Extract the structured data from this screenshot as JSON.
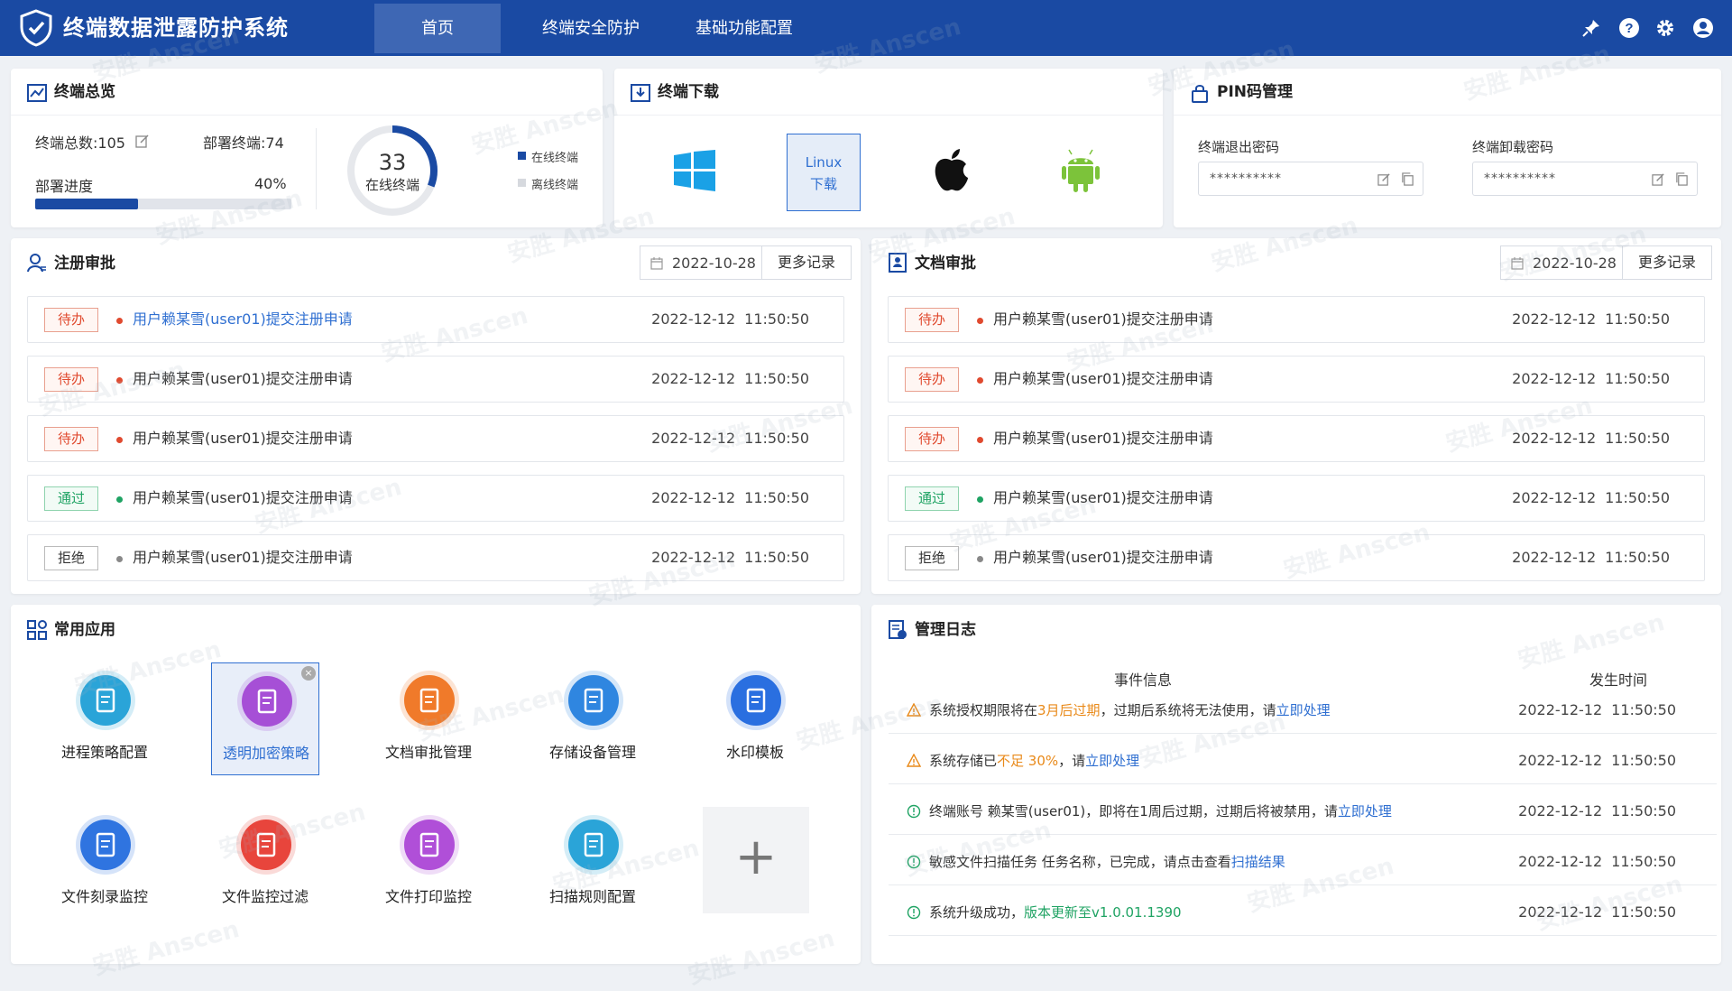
{
  "header": {
    "title": "终端数据泄露防护系统",
    "tabs": [
      {
        "label": "首页"
      },
      {
        "label": "终端安全防护"
      },
      {
        "label": "基础功能配置"
      }
    ]
  },
  "overview": {
    "title": "终端总览",
    "total_label": "终端总数:105",
    "deployed_label": "部署终端:74",
    "progress_label": "部署进度",
    "progress_text": "40%",
    "progress_value": 0.4,
    "online_count": "33",
    "online_label": "在线终端",
    "online_fraction": 0.31,
    "legend_online": "在线终端",
    "legend_offline": "离线终端"
  },
  "download": {
    "title": "终端下载",
    "linux_line1": "Linux",
    "linux_line2": "下载"
  },
  "pin": {
    "title": "PIN码管理",
    "exit_label": "终端退出密码",
    "exit_value": "**********",
    "uninstall_label": "终端卸载密码",
    "uninstall_value": "**********"
  },
  "register": {
    "title": "注册审批",
    "date": "2022-10-28",
    "more": "更多记录",
    "rows": [
      {
        "status": "待办",
        "message": "用户赖某雪(user01)提交注册申请",
        "date": "2022-12-12",
        "time": "11:50:50"
      },
      {
        "status": "待办",
        "message": "用户赖某雪(user01)提交注册申请",
        "date": "2022-12-12",
        "time": "11:50:50"
      },
      {
        "status": "待办",
        "message": "用户赖某雪(user01)提交注册申请",
        "date": "2022-12-12",
        "time": "11:50:50"
      },
      {
        "status": "通过",
        "message": "用户赖某雪(user01)提交注册申请",
        "date": "2022-12-12",
        "time": "11:50:50"
      },
      {
        "status": "拒绝",
        "message": "用户赖某雪(user01)提交注册申请",
        "date": "2022-12-12",
        "time": "11:50:50"
      }
    ]
  },
  "document": {
    "title": "文档审批",
    "date": "2022-10-28",
    "more": "更多记录",
    "rows": [
      {
        "status": "待办",
        "message": "用户赖某雪(user01)提交注册申请",
        "date": "2022-12-12",
        "time": "11:50:50"
      },
      {
        "status": "待办",
        "message": "用户赖某雪(user01)提交注册申请",
        "date": "2022-12-12",
        "time": "11:50:50"
      },
      {
        "status": "待办",
        "message": "用户赖某雪(user01)提交注册申请",
        "date": "2022-12-12",
        "time": "11:50:50"
      },
      {
        "status": "通过",
        "message": "用户赖某雪(user01)提交注册申请",
        "date": "2022-12-12",
        "time": "11:50:50"
      },
      {
        "status": "拒绝",
        "message": "用户赖某雪(user01)提交注册申请",
        "date": "2022-12-12",
        "time": "11:50:50"
      }
    ]
  },
  "apps": {
    "title": "常用应用",
    "items": [
      {
        "label": "进程策略配置",
        "icon": "process-policy-icon",
        "color": "#2aa4d8"
      },
      {
        "label": "透明加密策略",
        "icon": "encrypt-policy-icon",
        "color": "#a64fd6"
      },
      {
        "label": "文档审批管理",
        "icon": "doc-approval-icon",
        "color": "#f07a2a"
      },
      {
        "label": "存储设备管理",
        "icon": "storage-device-icon",
        "color": "#2f86e0"
      },
      {
        "label": "水印模板",
        "icon": "watermark-icon",
        "color": "#2a6fe0"
      },
      {
        "label": "文件刻录监控",
        "icon": "burn-monitor-icon",
        "color": "#2f74e0"
      },
      {
        "label": "文件监控过滤",
        "icon": "file-filter-icon",
        "color": "#e8453c"
      },
      {
        "label": "文件打印监控",
        "icon": "print-monitor-icon",
        "color": "#b04fd8"
      },
      {
        "label": "扫描规则配置",
        "icon": "scan-rule-icon",
        "color": "#2aa4d8"
      }
    ],
    "add_label": "+"
  },
  "logs": {
    "title": "管理日志",
    "col_event": "事件信息",
    "col_time": "发生时间",
    "rows": [
      {
        "level": "warning",
        "p1": "系统授权期限将在",
        "p2": "3月后过期",
        "p3": "，过期后系统将无法使用，请",
        "p4": "立即处理",
        "p5": "",
        "date": "2022-12-12",
        "time": "11:50:50"
      },
      {
        "level": "warning",
        "p1": "系统存储已",
        "p2": "不足 30%",
        "p3": "，请",
        "p4": "立即处理",
        "p5": "",
        "date": "2022-12-12",
        "time": "11:50:50"
      },
      {
        "level": "info",
        "p1": "终端账号 赖某雪(user01)，即将在1周后过期，过期后将被禁用，请",
        "p2": "",
        "p3": "",
        "p4": "立即处理",
        "p5": "",
        "date": "2022-12-12",
        "time": "11:50:50"
      },
      {
        "level": "info",
        "p1": "敏感文件扫描任务 任务名称，已完成，请点击查看",
        "p2": "",
        "p3": "",
        "p4": "扫描结果",
        "p5": "",
        "date": "2022-12-12",
        "time": "11:50:50"
      },
      {
        "level": "success",
        "p1": "系统升级成功，",
        "p2": "",
        "p3": "",
        "p4": "",
        "p5": "版本更新至v1.0.01.1390",
        "date": "2022-12-12",
        "time": "11:50:50"
      }
    ]
  },
  "watermark_text": "安胜 Anscen",
  "colors": {
    "brand": "#1a4aa3",
    "pending": "#e04a2f",
    "pass": "#1fa363",
    "warning": "#e98a1a",
    "link": "#2f6fd1"
  }
}
